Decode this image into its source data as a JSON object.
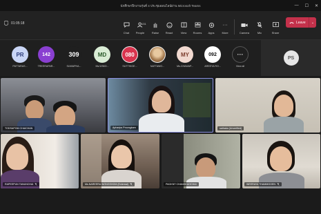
{
  "window": {
    "title": "นักศึกษาฝึกงานรุ่นที่ 4 ประชุมออนไลน์ผ่าน Microsoft Teams"
  },
  "meeting": {
    "timer": "01:05:18"
  },
  "toolbar": {
    "chat": "Chat",
    "people": "People",
    "people_count": "131",
    "raise": "Raise",
    "react": "React",
    "view": "View",
    "rooms": "Rooms",
    "apps": "Apps",
    "more": "More",
    "camera": "Camera",
    "mic": "Mic",
    "share": "Share",
    "leave": "Leave"
  },
  "participants_strip": [
    {
      "initials": "PR",
      "name": "PATTARAS...",
      "color": "#c9d5f5",
      "text": "#2b3a7a"
    },
    {
      "initials": "142",
      "name": "TREERAPAR...",
      "color": "#8a3fd1",
      "text": "#ffffff"
    },
    {
      "initials": "309",
      "name": "SUWAPHA...",
      "color": "#1f1f1f",
      "text": "#ffffff"
    },
    {
      "initials": "MD",
      "name": "Ms.WIMO...",
      "color": "#d9ecd5",
      "text": "#2b5a2b"
    },
    {
      "initials": "080",
      "name": "SUTTHIGE...",
      "color": "#d9344e",
      "text": "#ffffff"
    },
    {
      "initials": "",
      "name": "NATTAWO...",
      "color": "#c9a26e",
      "text": "#ffffff"
    },
    {
      "initials": "MY",
      "name": "Ms.CHAWAP...",
      "color": "#f1d9d0",
      "text": "#7a3b2b"
    },
    {
      "initials": "092",
      "name": "AREEYA RO...",
      "color": "#ffffff",
      "text": "#111111"
    }
  ],
  "view_all": {
    "label": "View all",
    "icon": "···"
  },
  "self_view": {
    "initials": "PS"
  },
  "tiles": [
    {
      "name": "TODSAPOM CHAICHAN"
    },
    {
      "name": "Apharips Proongkarn"
    },
    {
      "name": "sathaka (Unverified)"
    },
    {
      "name": "RAPEEPUN TANUNCHAI"
    },
    {
      "name": "Ms.NAREERA WONGSHOM (External)"
    },
    {
      "name": "PAGKNT CHANGKAOCHAI"
    },
    {
      "name": "WEERAYA THAMMGOEN"
    }
  ]
}
